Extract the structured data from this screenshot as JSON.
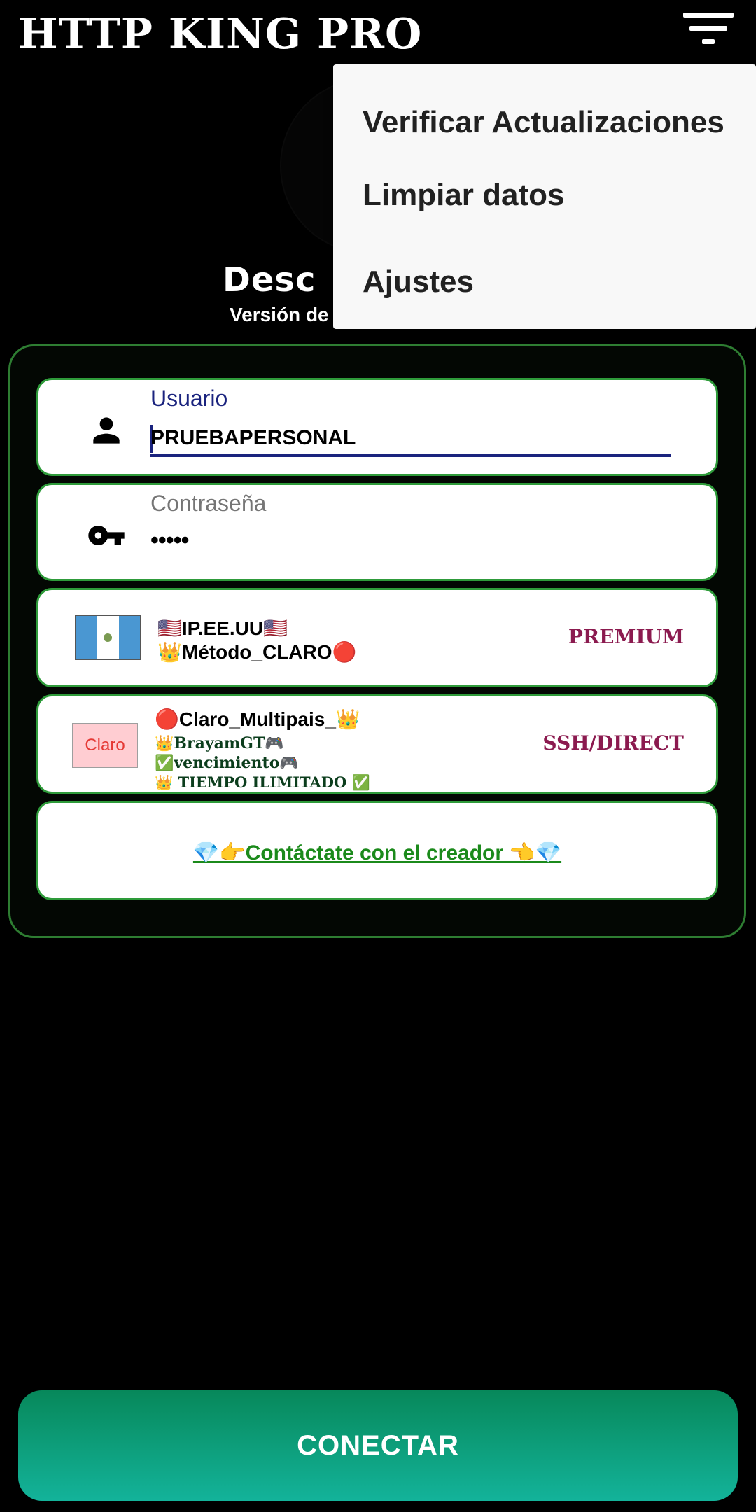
{
  "header": {
    "app_title": "HTTP KING PRO",
    "menu_icon": "filter-menu-icon"
  },
  "status": {
    "title_partial": "Desc",
    "version_partial": "Versión de"
  },
  "dropdown_menu": {
    "items": [
      {
        "label": "Verificar Actualizaciones"
      },
      {
        "label": "Limpiar datos"
      },
      {
        "label": "Ajustes"
      }
    ]
  },
  "form": {
    "username": {
      "label": "Usuario",
      "value": "PRUEBAPERSONAL",
      "icon": "person-icon"
    },
    "password": {
      "label": "Contraseña",
      "masked_value": "•••••",
      "icon": "key-icon"
    },
    "server": {
      "flag": "guatemala-flag-icon",
      "line1": "🇺🇸IP.EE.UU🇺🇸",
      "line2": "👑Método_CLARO🔴",
      "tag": "PREMIUM"
    },
    "payload": {
      "logo_text": "Claro",
      "title": "🔴Claro_Multipais_👑",
      "sub1": "👑BrayamGT🎮",
      "sub2": "✅vencimiento🎮",
      "sub3": "👑 TIEMPO ILIMITADO ✅",
      "tag": "SSH/DIRECT"
    },
    "contact": {
      "link_text": "💎👉Contáctate con el creador 👈💎"
    }
  },
  "connect_button": {
    "label": "CONECTAR"
  },
  "colors": {
    "background": "#000000",
    "card_border": "#2e9b3a",
    "tag_color": "#8b1a4f",
    "focus_blue": "#1a237e",
    "link_green": "#1b8a1b",
    "button_gradient_top": "#07885a",
    "button_gradient_bottom": "#13b39a"
  }
}
